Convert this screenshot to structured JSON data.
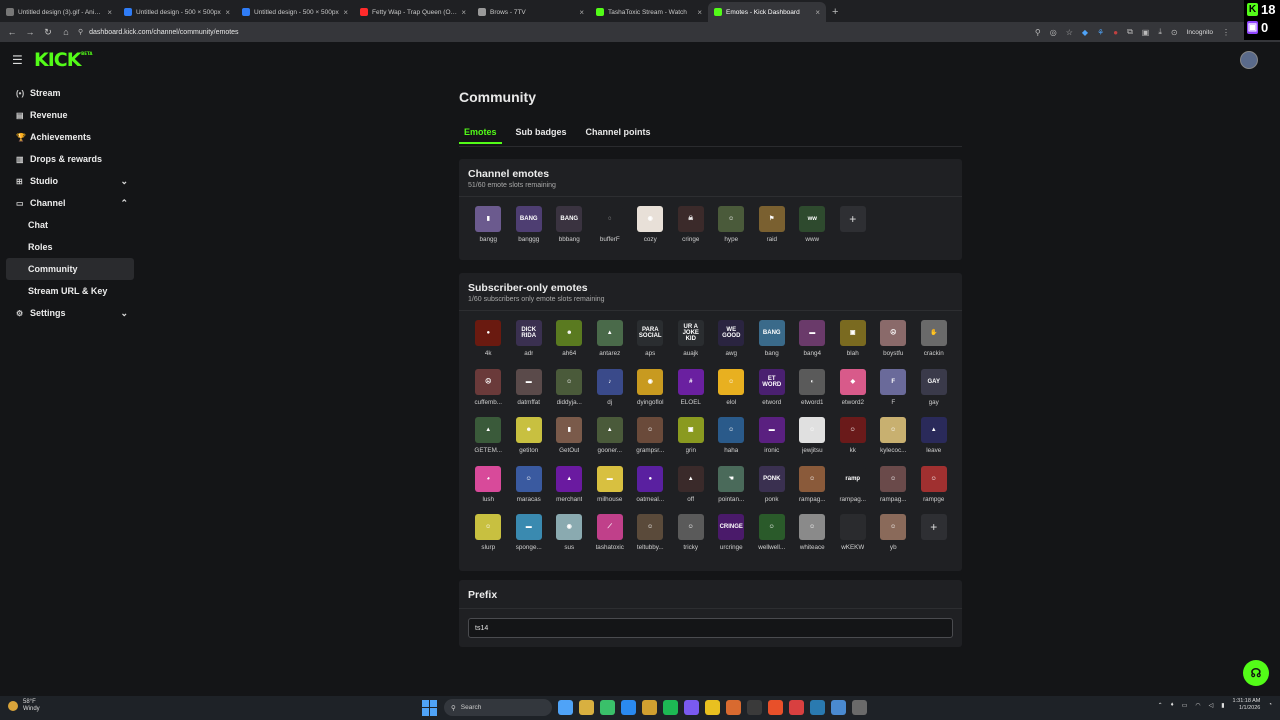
{
  "browser": {
    "tabs": [
      {
        "title": "Untitled design (3).gif - Animat",
        "color": "#777"
      },
      {
        "title": "Untitled design - 500 × 500px",
        "color": "#2f7cf6"
      },
      {
        "title": "Untitled design - 500 × 500px",
        "color": "#2f7cf6"
      },
      {
        "title": "Fetty Wap - Trap Queen (Officia",
        "color": "#ff2b2b"
      },
      {
        "title": "Brows - 7TV",
        "color": "#999"
      },
      {
        "title": "TashaToxic Stream - Watch",
        "color": "#53fc18"
      },
      {
        "title": "Emotes - Kick Dashboard",
        "color": "#53fc18"
      }
    ],
    "close_glyph": "×",
    "new_tab_glyph": "+",
    "url": "dashboard.kick.com/channel/community/emotes",
    "incognito_label": "Incognito",
    "overlay_kick_count": "18",
    "overlay_twitch_count": "0",
    "nav": {
      "back": "←",
      "forward": "→",
      "reload": "↻",
      "home": "⌂"
    }
  },
  "app": {
    "logo": "KICK",
    "logo_badge": "BETA",
    "sidebar": [
      {
        "label": "Stream",
        "icon": "(•)",
        "chevron": ""
      },
      {
        "label": "Revenue",
        "icon": "▤",
        "chevron": ""
      },
      {
        "label": "Achievements",
        "icon": "🏆",
        "chevron": ""
      },
      {
        "label": "Drops & rewards",
        "icon": "▥",
        "chevron": ""
      },
      {
        "label": "Studio",
        "icon": "⊞",
        "chevron": "⌄"
      },
      {
        "label": "Channel",
        "icon": "▭",
        "chevron": "⌃"
      }
    ],
    "sidebar_sub": [
      {
        "label": "Chat",
        "active": false
      },
      {
        "label": "Roles",
        "active": false
      },
      {
        "label": "Community",
        "active": true
      },
      {
        "label": "Stream URL & Key",
        "active": false
      }
    ],
    "sidebar_settings": {
      "label": "Settings",
      "icon": "⚙",
      "chevron": "⌄"
    },
    "page_title": "Community",
    "tabs": [
      {
        "label": "Emotes",
        "active": true
      },
      {
        "label": "Sub badges",
        "active": false
      },
      {
        "label": "Channel points",
        "active": false
      }
    ],
    "channel_emotes": {
      "title": "Channel emotes",
      "subtitle": "51/60 emote slots remaining",
      "items": [
        {
          "name": "bangg",
          "bg": "#6b5a8e",
          "txt": "▮"
        },
        {
          "name": "banggg",
          "bg": "#4e3e72",
          "txt": "BANG"
        },
        {
          "name": "bbbang",
          "bg": "#3a3340",
          "txt": "BANG"
        },
        {
          "name": "bufferF",
          "bg": "#1f2023",
          "txt": "◌"
        },
        {
          "name": "cozy",
          "bg": "#e8e0d8",
          "txt": "◉"
        },
        {
          "name": "cringe",
          "bg": "#3b2a2a",
          "txt": "☠"
        },
        {
          "name": "hype",
          "bg": "#4a5a3a",
          "txt": "☺"
        },
        {
          "name": "raid",
          "bg": "#7a6030",
          "txt": "⚑"
        },
        {
          "name": "www",
          "bg": "#2e4a2e",
          "txt": "ww"
        }
      ]
    },
    "sub_emotes": {
      "title": "Subscriber-only emotes",
      "subtitle": "1/60 subscribers only emote slots remaining",
      "items": [
        {
          "name": "4k",
          "bg": "#6a1a10",
          "txt": "●"
        },
        {
          "name": "adr",
          "bg": "#3a3050",
          "txt": "DICK RIDA"
        },
        {
          "name": "ah64",
          "bg": "#5a7a20",
          "txt": "☻"
        },
        {
          "name": "antarez",
          "bg": "#4a6a4a",
          "txt": "▲"
        },
        {
          "name": "aps",
          "bg": "#2a2d30",
          "txt": "PARA SOCIAL"
        },
        {
          "name": "auajk",
          "bg": "#2a2d30",
          "txt": "UR A JOKE KID"
        },
        {
          "name": "awg",
          "bg": "#2a2440",
          "txt": "WE GOOD"
        },
        {
          "name": "bang",
          "bg": "#3a6a8a",
          "txt": "BANG"
        },
        {
          "name": "bang4",
          "bg": "#6a3a6a",
          "txt": "▬"
        },
        {
          "name": "blah",
          "bg": "#7a6a20",
          "txt": "▣"
        },
        {
          "name": "boystfu",
          "bg": "#8a6a6a",
          "txt": "☹"
        },
        {
          "name": "crackin",
          "bg": "#6a6a6a",
          "txt": "✋"
        },
        {
          "name": "cuffemb...",
          "bg": "#6a3a3a",
          "txt": "☹"
        },
        {
          "name": "datmffat",
          "bg": "#5a4a4a",
          "txt": "▬"
        },
        {
          "name": "diddyja...",
          "bg": "#4a5a3a",
          "txt": "☺"
        },
        {
          "name": "dj",
          "bg": "#3a4a8a",
          "txt": "♪"
        },
        {
          "name": "dyingoflol",
          "bg": "#c89a20",
          "txt": "◉"
        },
        {
          "name": "ELOEL",
          "bg": "#6a20a0",
          "txt": "#"
        },
        {
          "name": "elol",
          "bg": "#e8b020",
          "txt": "☺"
        },
        {
          "name": "etword",
          "bg": "#4a2070",
          "txt": "ET WORD"
        },
        {
          "name": "etword1",
          "bg": "#5a5a5a",
          "txt": "◐"
        },
        {
          "name": "etword2",
          "bg": "#d85a8a",
          "txt": "◆"
        },
        {
          "name": "F",
          "bg": "#6a6a9a",
          "txt": "F"
        },
        {
          "name": "gay",
          "bg": "#3a3a4a",
          "txt": "GAY"
        },
        {
          "name": "GETEM...",
          "bg": "#3a5a3a",
          "txt": "▲"
        },
        {
          "name": "getiton",
          "bg": "#c8c040",
          "txt": "☻"
        },
        {
          "name": "GetOut",
          "bg": "#7a5a4a",
          "txt": "▮"
        },
        {
          "name": "gooner...",
          "bg": "#4a5a3a",
          "txt": "▲"
        },
        {
          "name": "grampsr...",
          "bg": "#6a4a3a",
          "txt": "☺"
        },
        {
          "name": "grin",
          "bg": "#8a9a20",
          "txt": "▣"
        },
        {
          "name": "haha",
          "bg": "#2a5a8a",
          "txt": "☺"
        },
        {
          "name": "ironic",
          "bg": "#5a2080",
          "txt": "▬"
        },
        {
          "name": "jewjitsu",
          "bg": "#e0e0e0",
          "txt": "☺"
        },
        {
          "name": "kk",
          "bg": "#6a1a1a",
          "txt": "☺"
        },
        {
          "name": "kylecoc...",
          "bg": "#c8b070",
          "txt": "☺"
        },
        {
          "name": "leave",
          "bg": "#2a2a5a",
          "txt": "▲"
        },
        {
          "name": "lush",
          "bg": "#d84a9a",
          "txt": "◕"
        },
        {
          "name": "maracas",
          "bg": "#3a5aa0",
          "txt": "☺"
        },
        {
          "name": "merchant",
          "bg": "#6a1aa0",
          "txt": "▲"
        },
        {
          "name": "milhouse",
          "bg": "#d8c040",
          "txt": "▬"
        },
        {
          "name": "oatmeal...",
          "bg": "#5a20a0",
          "txt": "●"
        },
        {
          "name": "off",
          "bg": "#3a2a2a",
          "txt": "▲"
        },
        {
          "name": "pointan...",
          "bg": "#4a6a5a",
          "txt": "☚"
        },
        {
          "name": "ponk",
          "bg": "#3a3050",
          "txt": "PONK"
        },
        {
          "name": "rampag...",
          "bg": "#8a5a3a",
          "txt": "☺"
        },
        {
          "name": "rampag...",
          "bg": "#1f2023",
          "txt": "ramp"
        },
        {
          "name": "rampag...",
          "bg": "#6a4a4a",
          "txt": "☺"
        },
        {
          "name": "rampge",
          "bg": "#a03030",
          "txt": "☺"
        },
        {
          "name": "slurp",
          "bg": "#c8c040",
          "txt": "☺"
        },
        {
          "name": "sponge...",
          "bg": "#3a8ab0",
          "txt": "▬"
        },
        {
          "name": "sus",
          "bg": "#8aaab0",
          "txt": "◉"
        },
        {
          "name": "tashatoxic",
          "bg": "#c0408a",
          "txt": "⟋"
        },
        {
          "name": "teltubby...",
          "bg": "#5a4a3a",
          "txt": "☺"
        },
        {
          "name": "tricky",
          "bg": "#5a5a5a",
          "txt": "☺"
        },
        {
          "name": "urcringe",
          "bg": "#4a1a6a",
          "txt": "CRINGE"
        },
        {
          "name": "wellwell...",
          "bg": "#2a5a2a",
          "txt": "☺"
        },
        {
          "name": "whiteace",
          "bg": "#8a8a8a",
          "txt": "☺"
        },
        {
          "name": "wKEKW",
          "bg": "#2a2b2e",
          "txt": ""
        },
        {
          "name": "yb",
          "bg": "#8a6a5a",
          "txt": "☺"
        }
      ]
    },
    "add_glyph": "+",
    "prefix": {
      "title": "Prefix",
      "value": "ts14"
    }
  },
  "taskbar": {
    "weather_temp": "58°F",
    "weather_desc": "Windy",
    "search_label": "Search",
    "time": "1:31:18 AM",
    "date": "1/1/2026",
    "icons": [
      "#4fa3f7",
      "#d8b040",
      "#3ac06a",
      "#2a8af0",
      "#d0a030",
      "#1db954",
      "#7a5af0",
      "#e8c020",
      "#d86a30",
      "#3a3a3a",
      "#e8502a",
      "#d84040",
      "#2a7ab0",
      "#4a8ad0",
      "#6a6a6a"
    ]
  }
}
